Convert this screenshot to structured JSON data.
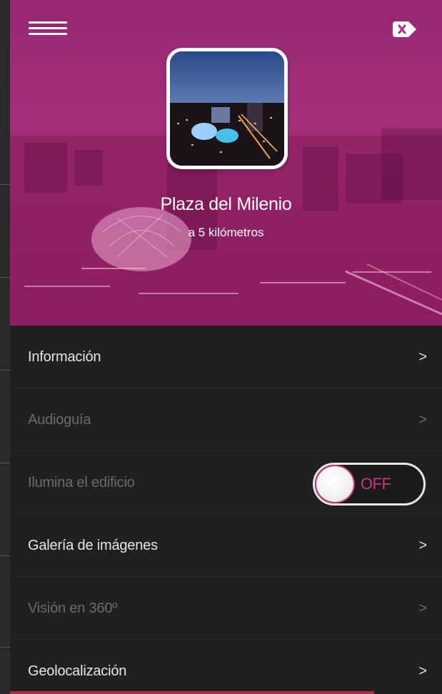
{
  "header": {
    "menu_icon": "hamburger-icon",
    "close_icon": "close-icon"
  },
  "place": {
    "name": "Plaza del Milenio",
    "distance": "a 5 kilómetros"
  },
  "menu": {
    "items": [
      {
        "label": "Información",
        "chevron": ">",
        "enabled": true
      },
      {
        "label": "Audioguía",
        "chevron": ">",
        "enabled": false
      },
      {
        "label": "Ilumina el edificio",
        "toggle_state": "OFF",
        "enabled": false
      },
      {
        "label": "Galería de imágenes",
        "chevron": ">",
        "enabled": true
      },
      {
        "label": "Visión en 360º",
        "chevron": ">",
        "enabled": false
      },
      {
        "label": "Geolocalización",
        "chevron": ">",
        "enabled": true
      }
    ]
  },
  "colors": {
    "accent": "#c43a7c",
    "hero_overlay": "#b03080",
    "menu_bg": "#202021"
  }
}
